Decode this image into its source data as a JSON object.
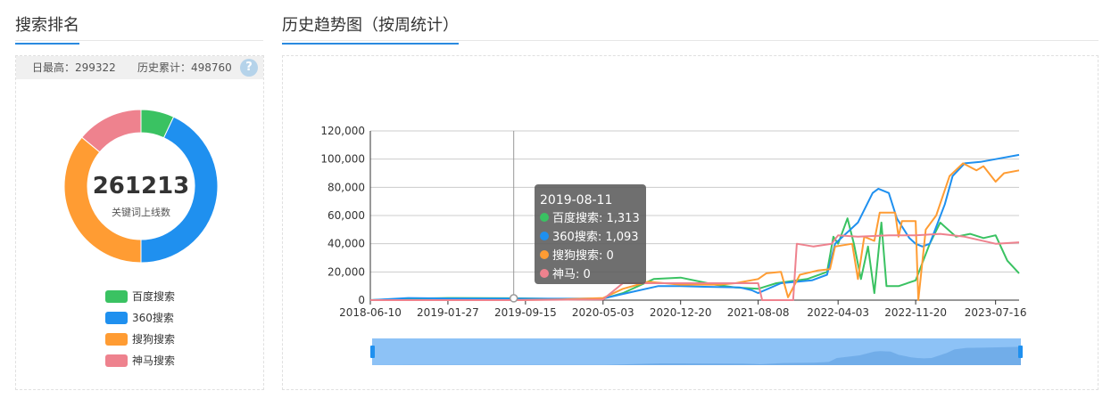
{
  "left": {
    "title": "搜索排名",
    "daily_max": "日最高：299322",
    "history_total": "历史累计：498760",
    "help_glyph": "?",
    "total_value": "261213",
    "total_label": "关键词上线数",
    "donut": [
      {
        "name": "百度搜索",
        "value": 0.07,
        "color": "#3ac262"
      },
      {
        "name": "360搜索",
        "value": 0.43,
        "color": "#1f90ef"
      },
      {
        "name": "搜狗搜索",
        "value": 0.36,
        "color": "#ff9c33"
      },
      {
        "name": "神马搜索",
        "value": 0.14,
        "color": "#ee828e"
      }
    ]
  },
  "right": {
    "title": "历史趋势图（按周统计）"
  },
  "tooltip": {
    "date": "2019-08-11",
    "rows": [
      {
        "text": "百度搜索: 1,313",
        "color": "#3ac262"
      },
      {
        "text": "360搜索: 1,093",
        "color": "#1f90ef"
      },
      {
        "text": "搜狗搜索: 0",
        "color": "#ff9c33"
      },
      {
        "text": "神马: 0",
        "color": "#ee828e"
      }
    ]
  },
  "chart_data": {
    "type": "line",
    "x_ticks": [
      "2018-06-10",
      "2019-01-27",
      "2019-09-15",
      "2020-05-03",
      "2020-12-20",
      "2021-08-08",
      "2022-04-03",
      "2022-11-20",
      "2023-07-16"
    ],
    "y_ticks": [
      "0",
      "20,000",
      "40,000",
      "60,000",
      "80,000",
      "100,000",
      "120,000"
    ],
    "ylim": [
      0,
      120000
    ],
    "xlim": [
      "2018-06-10",
      "2023-09-24"
    ],
    "grid": true,
    "series": [
      {
        "name": "百度搜索",
        "color": "#3ac262",
        "points": [
          [
            "2018-06-10",
            0
          ],
          [
            "2018-10-01",
            1000
          ],
          [
            "2019-01-27",
            1500
          ],
          [
            "2019-08-11",
            1313
          ],
          [
            "2020-01-01",
            800
          ],
          [
            "2020-05-03",
            1000
          ],
          [
            "2020-07-01",
            5000
          ],
          [
            "2020-10-01",
            15000
          ],
          [
            "2020-12-20",
            16000
          ],
          [
            "2021-04-01",
            11000
          ],
          [
            "2021-06-01",
            9000
          ],
          [
            "2021-08-08",
            8000
          ],
          [
            "2021-10-01",
            12000
          ],
          [
            "2022-01-01",
            15000
          ],
          [
            "2022-03-01",
            20000
          ],
          [
            "2022-03-20",
            45000
          ],
          [
            "2022-04-03",
            40000
          ],
          [
            "2022-05-01",
            58000
          ],
          [
            "2022-05-20",
            40000
          ],
          [
            "2022-06-10",
            15000
          ],
          [
            "2022-07-01",
            38000
          ],
          [
            "2022-07-20",
            5000
          ],
          [
            "2022-08-10",
            55000
          ],
          [
            "2022-08-25",
            10000
          ],
          [
            "2022-10-01",
            10000
          ],
          [
            "2022-11-20",
            14000
          ],
          [
            "2023-01-01",
            40000
          ],
          [
            "2023-02-01",
            55000
          ],
          [
            "2023-03-20",
            45000
          ],
          [
            "2023-05-01",
            47000
          ],
          [
            "2023-06-10",
            44000
          ],
          [
            "2023-07-16",
            46000
          ],
          [
            "2023-08-20",
            28000
          ],
          [
            "2023-09-24",
            19000
          ]
        ]
      },
      {
        "name": "360搜索",
        "color": "#1f90ef",
        "points": [
          [
            "2018-06-10",
            0
          ],
          [
            "2018-10-01",
            1500
          ],
          [
            "2019-01-27",
            1200
          ],
          [
            "2019-08-11",
            1093
          ],
          [
            "2020-01-01",
            1000
          ],
          [
            "2020-05-03",
            1200
          ],
          [
            "2020-08-01",
            6000
          ],
          [
            "2020-10-15",
            10000
          ],
          [
            "2020-12-20",
            10000
          ],
          [
            "2021-03-01",
            9500
          ],
          [
            "2021-06-15",
            9000
          ],
          [
            "2021-07-20",
            7000
          ],
          [
            "2021-08-08",
            5000
          ],
          [
            "2021-10-15",
            12000
          ],
          [
            "2022-01-15",
            14000
          ],
          [
            "2022-03-01",
            18000
          ],
          [
            "2022-03-25",
            40000
          ],
          [
            "2022-04-03",
            42000
          ],
          [
            "2022-06-01",
            55000
          ],
          [
            "2022-07-15",
            76000
          ],
          [
            "2022-08-01",
            79000
          ],
          [
            "2022-09-01",
            76000
          ],
          [
            "2022-09-25",
            58000
          ],
          [
            "2022-11-01",
            44000
          ],
          [
            "2022-11-20",
            40000
          ],
          [
            "2022-12-10",
            38000
          ],
          [
            "2023-01-01",
            40000
          ],
          [
            "2023-02-15",
            68000
          ],
          [
            "2023-03-10",
            88000
          ],
          [
            "2023-04-15",
            97000
          ],
          [
            "2023-06-01",
            98000
          ],
          [
            "2023-07-16",
            100000
          ],
          [
            "2023-09-24",
            103000
          ]
        ]
      },
      {
        "name": "搜狗搜索",
        "color": "#ff9c33",
        "points": [
          [
            "2018-06-10",
            0
          ],
          [
            "2019-08-11",
            0
          ],
          [
            "2020-01-01",
            500
          ],
          [
            "2020-05-03",
            1500
          ],
          [
            "2020-07-01",
            8000
          ],
          [
            "2020-09-15",
            13000
          ],
          [
            "2020-12-20",
            11000
          ],
          [
            "2021-04-15",
            11000
          ],
          [
            "2021-06-01",
            12000
          ],
          [
            "2021-08-08",
            15000
          ],
          [
            "2021-09-01",
            19000
          ],
          [
            "2021-10-15",
            20000
          ],
          [
            "2021-11-05",
            2000
          ],
          [
            "2021-12-10",
            18000
          ],
          [
            "2022-02-01",
            21000
          ],
          [
            "2022-03-10",
            22000
          ],
          [
            "2022-03-25",
            38000
          ],
          [
            "2022-05-15",
            40000
          ],
          [
            "2022-06-01",
            15000
          ],
          [
            "2022-06-20",
            45000
          ],
          [
            "2022-07-20",
            42000
          ],
          [
            "2022-08-05",
            62000
          ],
          [
            "2022-09-20",
            62000
          ],
          [
            "2022-09-30",
            45000
          ],
          [
            "2022-10-10",
            56000
          ],
          [
            "2022-11-20",
            56000
          ],
          [
            "2022-11-28",
            0
          ],
          [
            "2022-12-20",
            50000
          ],
          [
            "2023-01-20",
            60000
          ],
          [
            "2023-03-01",
            88000
          ],
          [
            "2023-04-10",
            97000
          ],
          [
            "2023-05-20",
            92000
          ],
          [
            "2023-06-10",
            95000
          ],
          [
            "2023-07-16",
            84000
          ],
          [
            "2023-08-10",
            90000
          ],
          [
            "2023-09-24",
            92000
          ]
        ]
      },
      {
        "name": "神马搜索",
        "color": "#ee828e",
        "points": [
          [
            "2018-06-10",
            0
          ],
          [
            "2019-08-11",
            0
          ],
          [
            "2020-05-03",
            500
          ],
          [
            "2020-07-01",
            12000
          ],
          [
            "2020-12-20",
            12000
          ],
          [
            "2021-08-08",
            12000
          ],
          [
            "2021-08-20",
            0
          ],
          [
            "2021-11-20",
            0
          ],
          [
            "2021-12-01",
            40000
          ],
          [
            "2022-01-20",
            38000
          ],
          [
            "2022-03-15",
            40000
          ],
          [
            "2022-04-03",
            46000
          ],
          [
            "2022-06-01",
            45000
          ],
          [
            "2022-09-01",
            46000
          ],
          [
            "2022-11-20",
            46000
          ],
          [
            "2023-02-01",
            47000
          ],
          [
            "2023-04-15",
            45000
          ],
          [
            "2023-07-16",
            40000
          ],
          [
            "2023-09-24",
            41000
          ]
        ]
      }
    ]
  }
}
